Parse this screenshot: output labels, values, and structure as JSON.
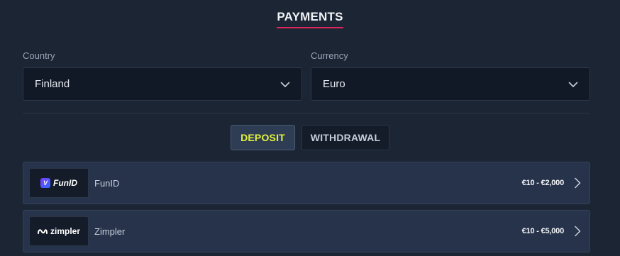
{
  "page": {
    "title": "PAYMENTS"
  },
  "country": {
    "label": "Country",
    "value": "Finland",
    "icon": "chevron-down-icon"
  },
  "currency": {
    "label": "Currency",
    "value": "Euro",
    "icon": "chevron-down-icon"
  },
  "tabs": [
    {
      "label": "DEPOSIT",
      "active": true
    },
    {
      "label": "WITHDRAWAL",
      "active": false
    }
  ],
  "methods": [
    {
      "name": "FunID",
      "logo_text": "FunID",
      "logo_icon": "funid-logo-icon",
      "range": "€10 - €2,000",
      "icon": "chevron-right-icon"
    },
    {
      "name": "Zimpler",
      "logo_text": "zimpler",
      "logo_icon": "zimpler-logo-icon",
      "range": "€10 - €5,000",
      "icon": "chevron-right-icon"
    }
  ],
  "colors": {
    "background": "#1b2534",
    "accent_underline": "#e0245e",
    "active_tab_text": "#e3f23a",
    "row_background": "#26334a"
  }
}
